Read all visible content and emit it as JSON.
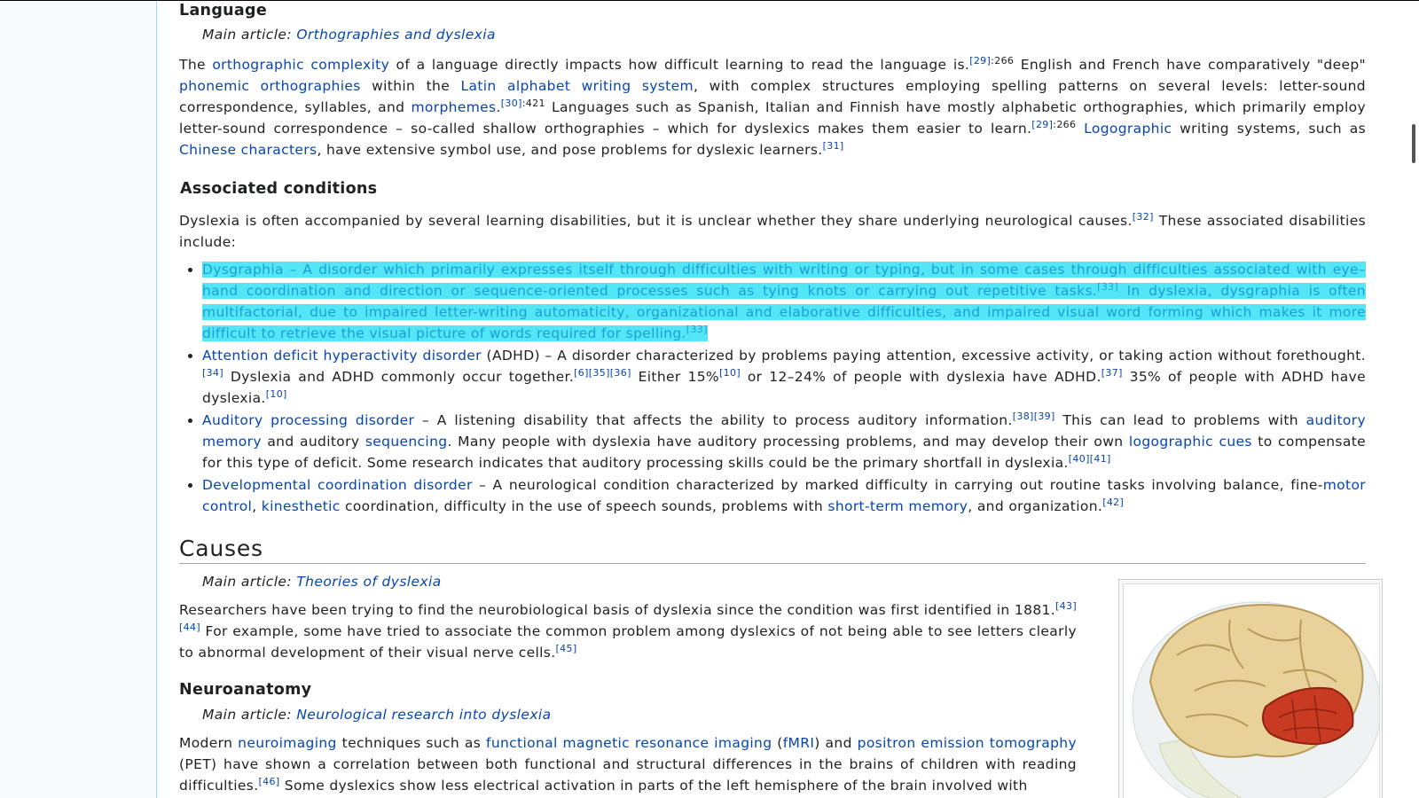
{
  "language": {
    "heading": "Language",
    "hatnote_prefix": "Main article: ",
    "hatnote_link": "Orthographies and dyslexia",
    "p": {
      "t1": "The ",
      "l1": "orthographic complexity",
      "t2": " of a language directly impacts how difficult learning to read the language is.",
      "r1": "[29]",
      "pg1": ":266",
      "t3": " English and French have comparatively \"deep\" ",
      "l2": "phonemic orthographies",
      "t4": " within the ",
      "l3": "Latin alphabet writing system",
      "t5": ", with complex structures employing spelling patterns on several levels: letter-sound correspondence, syllables, and ",
      "l4": "morphemes",
      "t6": ".",
      "r2": "[30]",
      "pg2": ":421",
      "t7": " Languages such as Spanish, Italian and Finnish have mostly alphabetic orthographies, which primarily employ letter-sound correspondence – so-called shallow orthographies – which for dyslexics makes them easier to learn.",
      "r3": "[29]",
      "pg3": ":266",
      "t8": " ",
      "l5": "Logographic",
      "t9": " writing systems, such as ",
      "l6": "Chinese characters",
      "t10": ", have extensive symbol use, and pose problems for dyslexic learners.",
      "r4": "[31]"
    }
  },
  "associated": {
    "heading": "Associated conditions",
    "p": {
      "t1": "Dyslexia is often accompanied by several learning disabilities, but it is unclear whether they share underlying neurological causes.",
      "r1": "[32]",
      "t2": " These associated disabilities include:"
    },
    "items": [
      {
        "l1": "Dysgraphia",
        "t1": " – A disorder which primarily expresses itself through difficulties with writing or typing, but in some cases through difficulties associated with eye–hand coordination and direction or sequence-oriented processes such as tying knots or carrying out repetitive tasks.",
        "r1": "[33]",
        "t2": " In dyslexia, dysgraphia is often multifactorial, due to impaired letter-writing automaticity, organizational and elaborative difficulties, and impaired visual word forming which makes it more difficult to retrieve the visual picture of words required for spelling.",
        "r2": "[33]"
      },
      {
        "l1": "Attention deficit hyperactivity disorder",
        "t1": " (ADHD) – A disorder characterized by problems paying attention, excessive activity, or taking action without forethought.",
        "r1": "[34]",
        "t2": " Dyslexia and ADHD commonly occur together.",
        "r2": "[6]",
        "r3": "[35]",
        "r4": "[36]",
        "t3": " Either 15%",
        "r5": "[10]",
        "t4": " or 12–24% of people with dyslexia have ADHD.",
        "r6": "[37]",
        "t5": " 35% of people with ADHD have dyslexia.",
        "r7": "[10]"
      },
      {
        "l1": "Auditory processing disorder",
        "t1": " – A listening disability that affects the ability to process auditory information.",
        "r1": "[38]",
        "r2": "[39]",
        "t2": " This can lead to problems with ",
        "l2": "auditory memory",
        "t3": " and auditory ",
        "l3": "sequencing",
        "t4": ". Many people with dyslexia have auditory processing problems, and may develop their own ",
        "l4": "logographic cues",
        "t5": " to compensate for this type of deficit. Some research indicates that auditory processing skills could be the primary shortfall in dyslexia.",
        "r3": "[40]",
        "r4": "[41]"
      },
      {
        "l1": "Developmental coordination disorder",
        "t1": " – A neurological condition characterized by marked difficulty in carrying out routine tasks involving balance, fine-",
        "l2": "motor control",
        "t2": ", ",
        "l3": "kinesthetic",
        "t3": " coordination, difficulty in the use of speech sounds, problems with ",
        "l4": "short-term memory",
        "t4": ", and organization.",
        "r1": "[42]"
      }
    ]
  },
  "causes": {
    "heading": "Causes",
    "hatnote_prefix": "Main article: ",
    "hatnote_link": "Theories of dyslexia",
    "p": {
      "t1": "Researchers have been trying to find the neurobiological basis of dyslexia since the condition was first identified in 1881.",
      "r1": "[43]",
      "r2": "[44]",
      "t2": " For example, some have tried to associate the common problem among dyslexics of not being able to see letters clearly to abnormal development of their visual nerve cells.",
      "r3": "[45]"
    }
  },
  "neuro": {
    "heading": "Neuroanatomy",
    "hatnote_prefix": "Main article: ",
    "hatnote_link": "Neurological research into dyslexia",
    "p": {
      "t1": "Modern ",
      "l1": "neuroimaging",
      "t2": " techniques such as ",
      "l2": "functional magnetic resonance imaging",
      "t3": " (",
      "l3": "fMRI",
      "t4": ") and ",
      "l4": "positron emission tomography",
      "t5": " (PET) have shown a correlation between both functional and structural differences in the brains of children with reading difficulties.",
      "r1": "[46]",
      "t6": " Some dyslexics show less electrical activation in parts of the left hemisphere of the brain involved with"
    }
  },
  "colors": {
    "link": "#0645ad",
    "highlight": "#53e6f6",
    "highlight_text": "#1c9fd6"
  }
}
